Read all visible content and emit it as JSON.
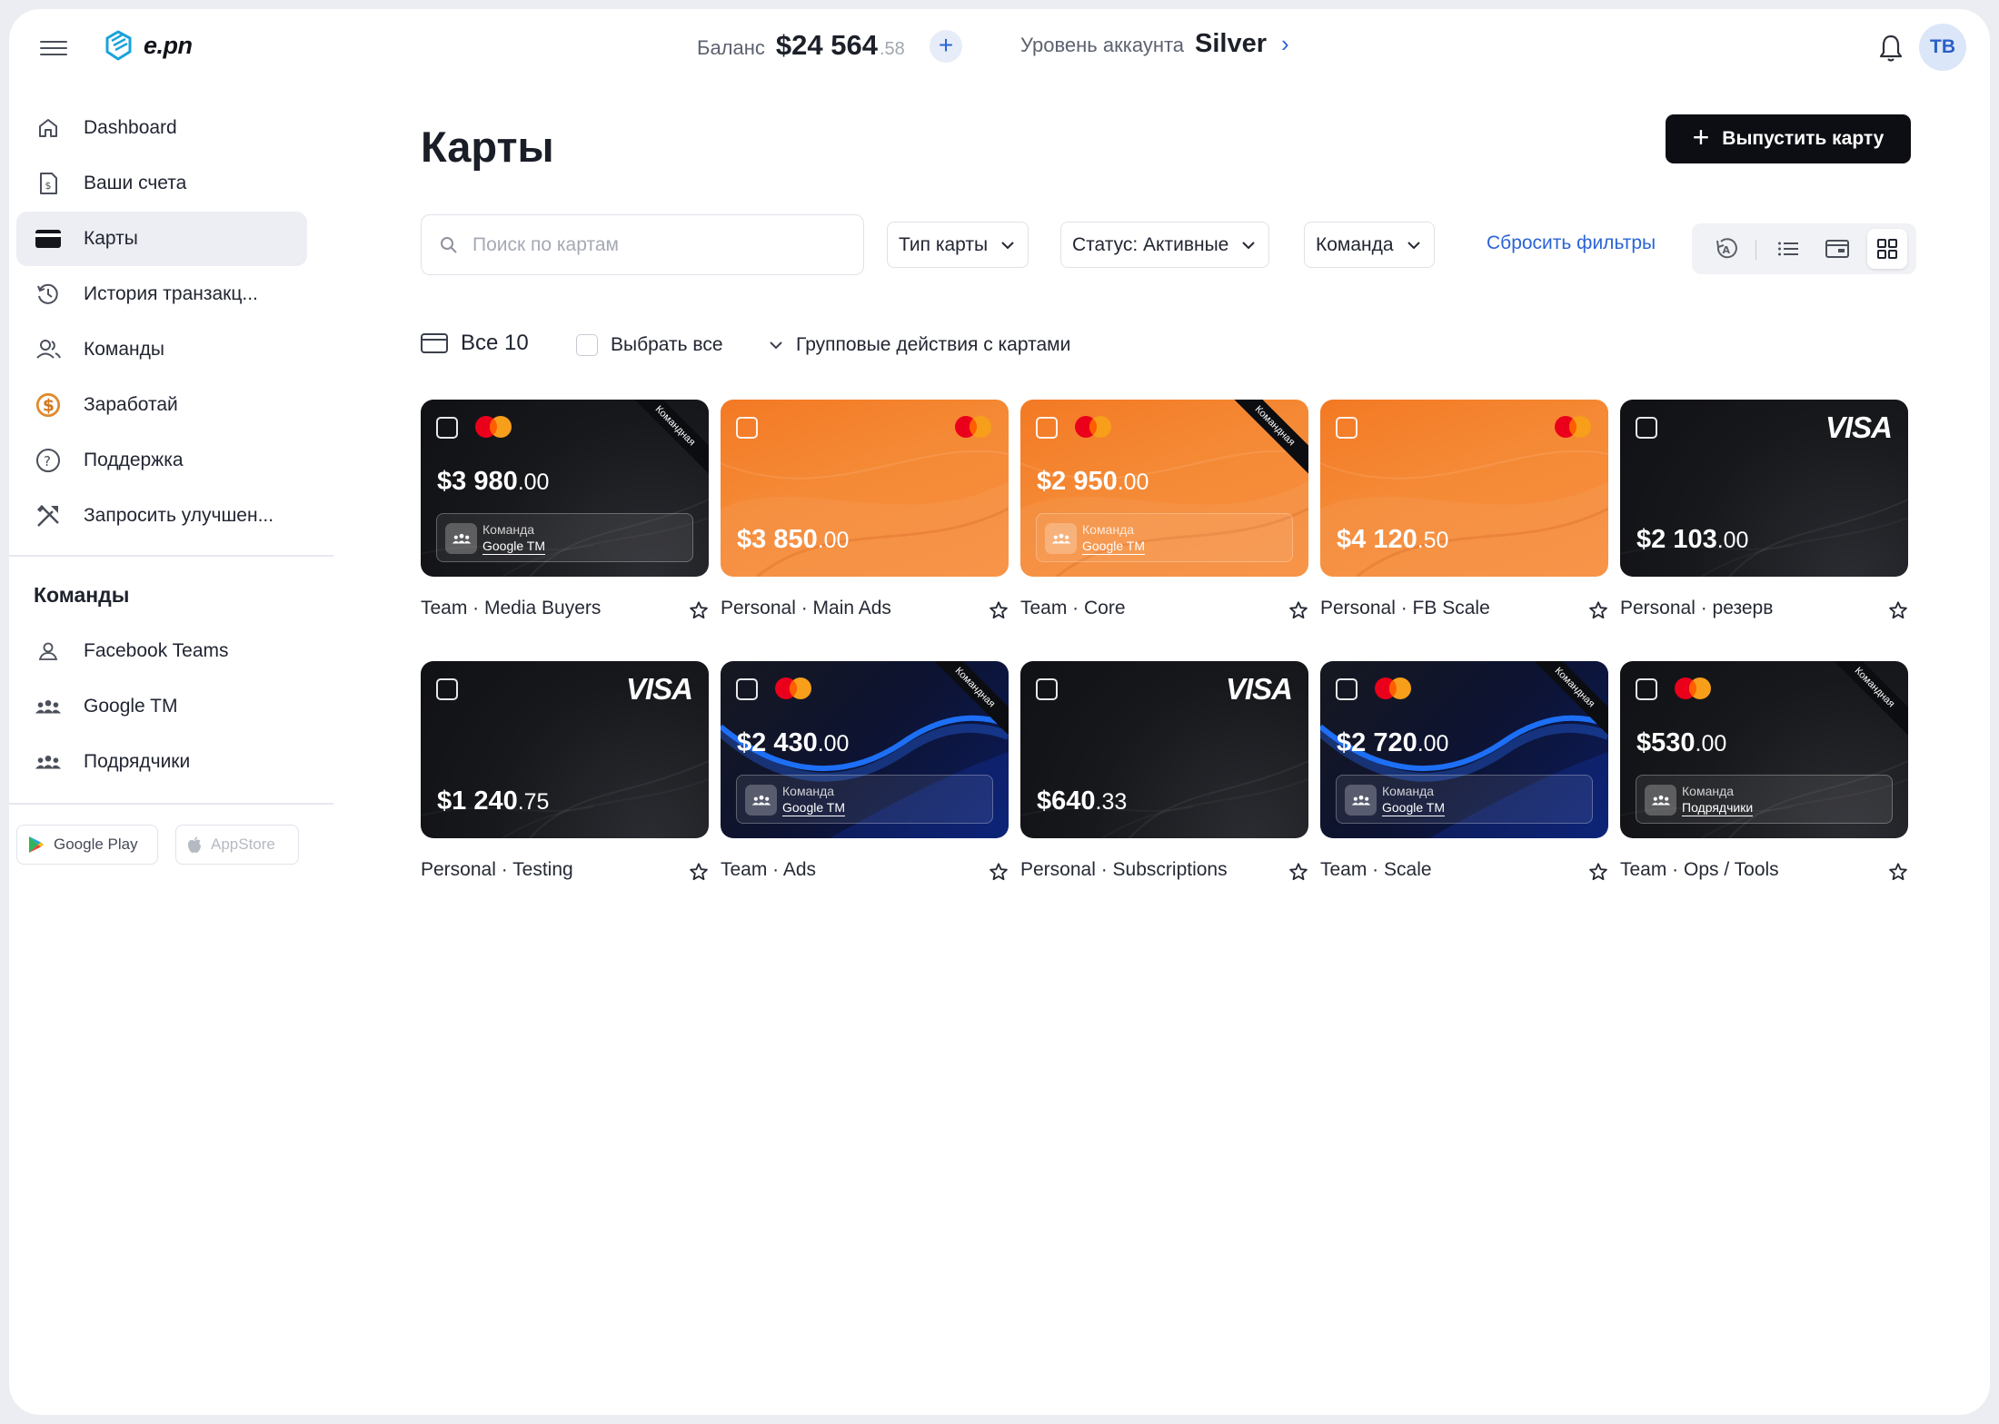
{
  "header": {
    "logo": "e.pn",
    "balance_label": "Баланс",
    "balance_main": "$24 564",
    "balance_cents": ".58",
    "add_label": "+",
    "level_label": "Уровень аккаунта",
    "level_value": "Silver",
    "avatar_initials": "TB"
  },
  "nav": [
    {
      "label": "Dashboard",
      "icon": "home-icon"
    },
    {
      "label": "Ваши счета",
      "icon": "invoice-icon"
    },
    {
      "label": "Карты",
      "icon": "card-icon",
      "active": true
    },
    {
      "label": "История транзакц...",
      "icon": "history-icon"
    },
    {
      "label": "Команды",
      "icon": "people-icon"
    },
    {
      "label": "Заработай",
      "icon": "dollar-coin-icon"
    },
    {
      "label": "Поддержка",
      "icon": "help-icon"
    },
    {
      "label": "Запросить улучшен...",
      "icon": "tools-icon"
    }
  ],
  "teams_title": "Команды",
  "teams": [
    {
      "label": "Facebook Teams",
      "icon": "user-icon"
    },
    {
      "label": "Google TM",
      "icon": "group-icon"
    },
    {
      "label": "Подрядчики",
      "icon": "group-icon"
    }
  ],
  "stores": {
    "google_play": "Google Play",
    "app_store": "AppStore"
  },
  "main": {
    "title": "Карты",
    "issue_button": "Выпустить карту",
    "search_placeholder": "Поиск по картам",
    "filters": [
      "Тип карты",
      "Статус: Активные",
      "Команда"
    ],
    "reset_filters": "Сбросить фильтры",
    "all_label": "Все 10",
    "select_all": "Выбрать все",
    "group_actions": "Групповые действия с картами"
  },
  "card_common": {
    "team_ribbon": "Командная",
    "team_label": "Команда"
  },
  "cards": [
    {
      "style": "black",
      "brand": "mastercard",
      "amount": "$3 980",
      "cents": ".00",
      "team": "Google TM",
      "ribbon": true,
      "caption": "Team · Media Buyers"
    },
    {
      "style": "orange",
      "brand": "mastercard",
      "amount": "$3 850",
      "cents": ".00",
      "team": null,
      "ribbon": false,
      "caption": "Personal · Main Ads"
    },
    {
      "style": "orange",
      "brand": "mastercard",
      "amount": "$2 950",
      "cents": ".00",
      "team": "Google TM",
      "ribbon": true,
      "caption": "Team · Core"
    },
    {
      "style": "orange",
      "brand": "mastercard",
      "amount": "$4 120",
      "cents": ".50",
      "team": null,
      "ribbon": false,
      "caption": "Personal · FB Scale"
    },
    {
      "style": "black",
      "brand": "visa",
      "amount": "$2 103",
      "cents": ".00",
      "team": null,
      "ribbon": false,
      "caption": "Personal · резерв"
    },
    {
      "style": "black",
      "brand": "visa",
      "amount": "$1 240",
      "cents": ".75",
      "team": null,
      "ribbon": false,
      "caption": "Personal · Testing"
    },
    {
      "style": "blue",
      "brand": "mastercard",
      "amount": "$2 430",
      "cents": ".00",
      "team": "Google TM",
      "ribbon": true,
      "caption": "Team · Ads"
    },
    {
      "style": "black",
      "brand": "visa",
      "amount": "$640",
      "cents": ".33",
      "team": null,
      "ribbon": false,
      "caption": "Personal · Subscriptions"
    },
    {
      "style": "blue",
      "brand": "mastercard",
      "amount": "$2 720",
      "cents": ".00",
      "team": "Google TM",
      "ribbon": true,
      "caption": "Team · Scale"
    },
    {
      "style": "black",
      "brand": "mastercard",
      "amount": "$530",
      "cents": ".00",
      "team": "Подрядчики",
      "ribbon": true,
      "caption": "Team · Ops / Tools"
    }
  ],
  "colors": {
    "accent": "#2a64d6",
    "card_orange": "#f58a36",
    "card_black": "#17181c",
    "card_blue": "#0b1c5e",
    "mastercard_red": "#eb001b",
    "mastercard_yellow": "#f79e1b"
  }
}
